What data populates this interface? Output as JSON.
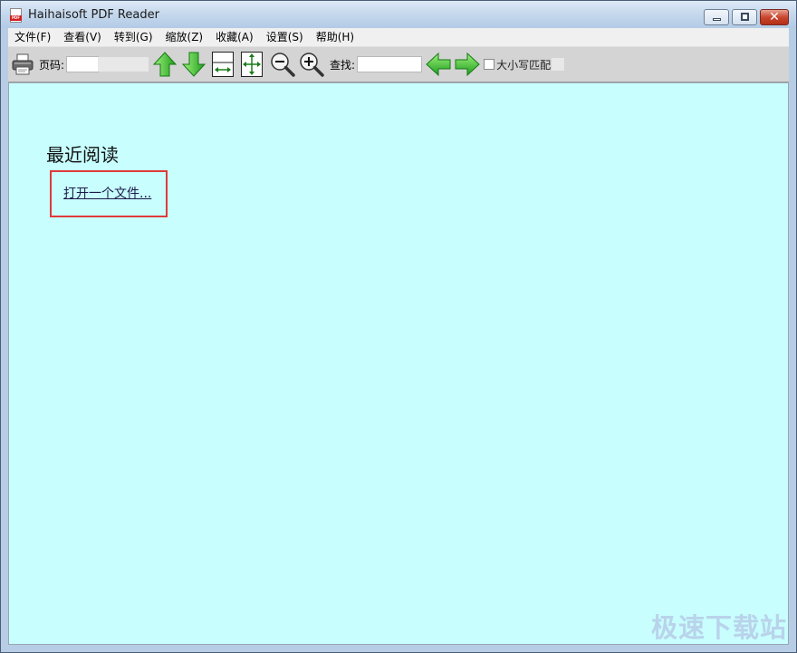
{
  "window": {
    "title": "Haihaisoft PDF Reader",
    "app_icon_text": "PDF",
    "controls": {
      "close_glyph": "✕"
    }
  },
  "menu": {
    "items": [
      {
        "label": "文件(F)"
      },
      {
        "label": "查看(V)"
      },
      {
        "label": "转到(G)"
      },
      {
        "label": "缩放(Z)"
      },
      {
        "label": "收藏(A)"
      },
      {
        "label": "设置(S)"
      },
      {
        "label": "帮助(H)"
      }
    ]
  },
  "toolbar": {
    "page_label": "页码:",
    "page_value": "",
    "search_label": "查找:",
    "search_value": "",
    "case_label": "大小写匹配",
    "case_checked": false,
    "icons": [
      "printer-icon",
      "arrow-up-icon",
      "arrow-down-icon",
      "fit-width-icon",
      "fit-page-icon",
      "zoom-out-icon",
      "zoom-in-icon",
      "find-prev-icon",
      "find-next-icon"
    ]
  },
  "content": {
    "recent_title": "最近阅读",
    "open_file_link": "打开一个文件...",
    "background_color": "#c8fefe",
    "highlight_color": "#e03a3a"
  },
  "watermark": "极速下载站"
}
